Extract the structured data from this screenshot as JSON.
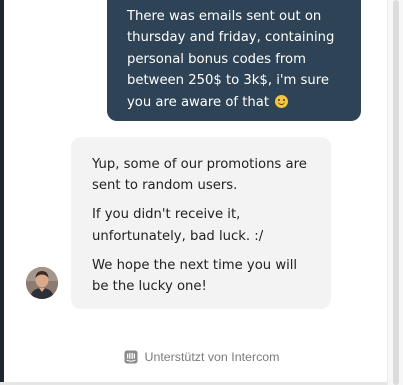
{
  "conversation": {
    "user_message": {
      "text": "There was emails sent out on thursday and friday, containing personal bonus codes from between 250$ to 3k$, i'm sure you are aware of that",
      "emoji_icon": "wink-emoji-icon"
    },
    "agent_message": {
      "paragraphs": [
        "Yup, some of our promotions are sent to random users.",
        "If you didn't receive it, unfortunately, bad luck. :/",
        "We hope the next time you will be the lucky one!"
      ],
      "avatar_icon": "agent-avatar"
    }
  },
  "footer": {
    "label": "Unterstützt von Intercom",
    "icon": "intercom-icon"
  },
  "colors": {
    "user_bubble": "#2f4356",
    "agent_bubble": "#f3f3f3",
    "footer_text": "#7a7a7a"
  }
}
